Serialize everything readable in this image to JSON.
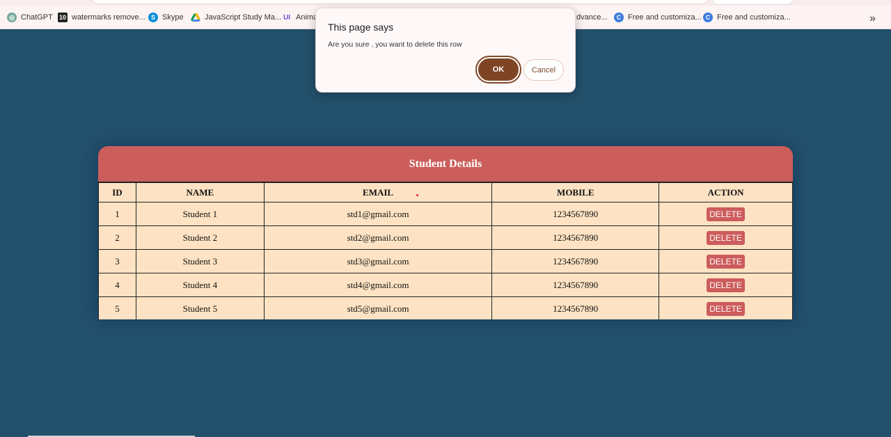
{
  "bookmarks": [
    {
      "label": "ChatGPT",
      "icon": "chatgpt-icon",
      "color": "#74aa9c"
    },
    {
      "label": "watermarks remove...",
      "icon": "10-icon",
      "color": "#222222"
    },
    {
      "label": "Skype",
      "icon": "skype-icon",
      "color": "#0a8fd8"
    },
    {
      "label": "JavaScript Study Ma...",
      "icon": "drive-icon",
      "color": "#f4b400"
    },
    {
      "label": "Animat",
      "icon": "ui-icon",
      "color": "#6b4cd8"
    },
    {
      "label": "dvance...",
      "icon": "",
      "color": ""
    },
    {
      "label": "Free and customiza...",
      "icon": "canva-icon",
      "color": "#3a7be0"
    },
    {
      "label": "Free and customiza...",
      "icon": "canva-icon",
      "color": "#3a7be0"
    }
  ],
  "bookmarks_more": "»",
  "dialog": {
    "title": "This page says",
    "message": "Are you sure , you want to delete this row",
    "ok_label": "OK",
    "cancel_label": "Cancel"
  },
  "table": {
    "title": "Student Details",
    "headers": [
      "ID",
      "NAME",
      "EMAIL",
      "MOBILE",
      "ACTION"
    ],
    "rows": [
      {
        "id": "1",
        "name": "Student 1",
        "email": "std1@gmail.com",
        "mobile": "1234567890",
        "action": "DELETE"
      },
      {
        "id": "2",
        "name": "Student 2",
        "email": "std2@gmail.com",
        "mobile": "1234567890",
        "action": "DELETE"
      },
      {
        "id": "3",
        "name": "Student 3",
        "email": "std3@gmail.com",
        "mobile": "1234567890",
        "action": "DELETE"
      },
      {
        "id": "4",
        "name": "Student 4",
        "email": "std4@gmail.com",
        "mobile": "1234567890",
        "action": "DELETE"
      },
      {
        "id": "5",
        "name": "Student 5",
        "email": "std5@gmail.com",
        "mobile": "1234567890",
        "action": "DELETE"
      }
    ]
  },
  "colors": {
    "background": "#23506b",
    "header": "#cb5e5b",
    "table_body": "#fde3c3",
    "ok_button": "#7e4524"
  }
}
